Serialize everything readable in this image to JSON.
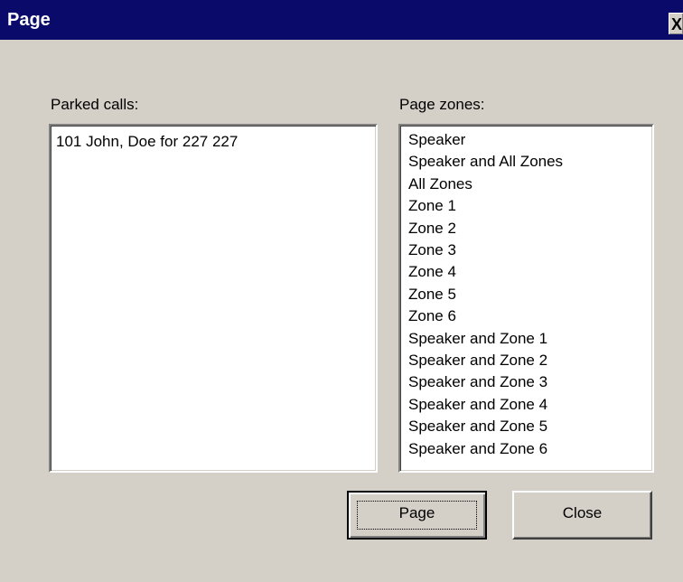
{
  "window": {
    "title": "Page",
    "close_glyph": "X"
  },
  "parked_calls": {
    "label": "Parked calls:",
    "items": [
      "101 John, Doe  for 227 227"
    ]
  },
  "page_zones": {
    "label": "Page zones:",
    "items": [
      "Speaker",
      "Speaker and All Zones",
      "All Zones",
      "Zone 1",
      "Zone 2",
      "Zone 3",
      "Zone 4",
      "Zone 5",
      "Zone 6",
      "Speaker and Zone 1",
      "Speaker and Zone 2",
      "Speaker and Zone 3",
      "Speaker and Zone 4",
      "Speaker and Zone 5",
      "Speaker and Zone 6"
    ]
  },
  "buttons": {
    "page_label": "Page",
    "close_label": "Close"
  },
  "colors": {
    "titlebar": "#0a0a6a",
    "face": "#d4d0c8"
  }
}
